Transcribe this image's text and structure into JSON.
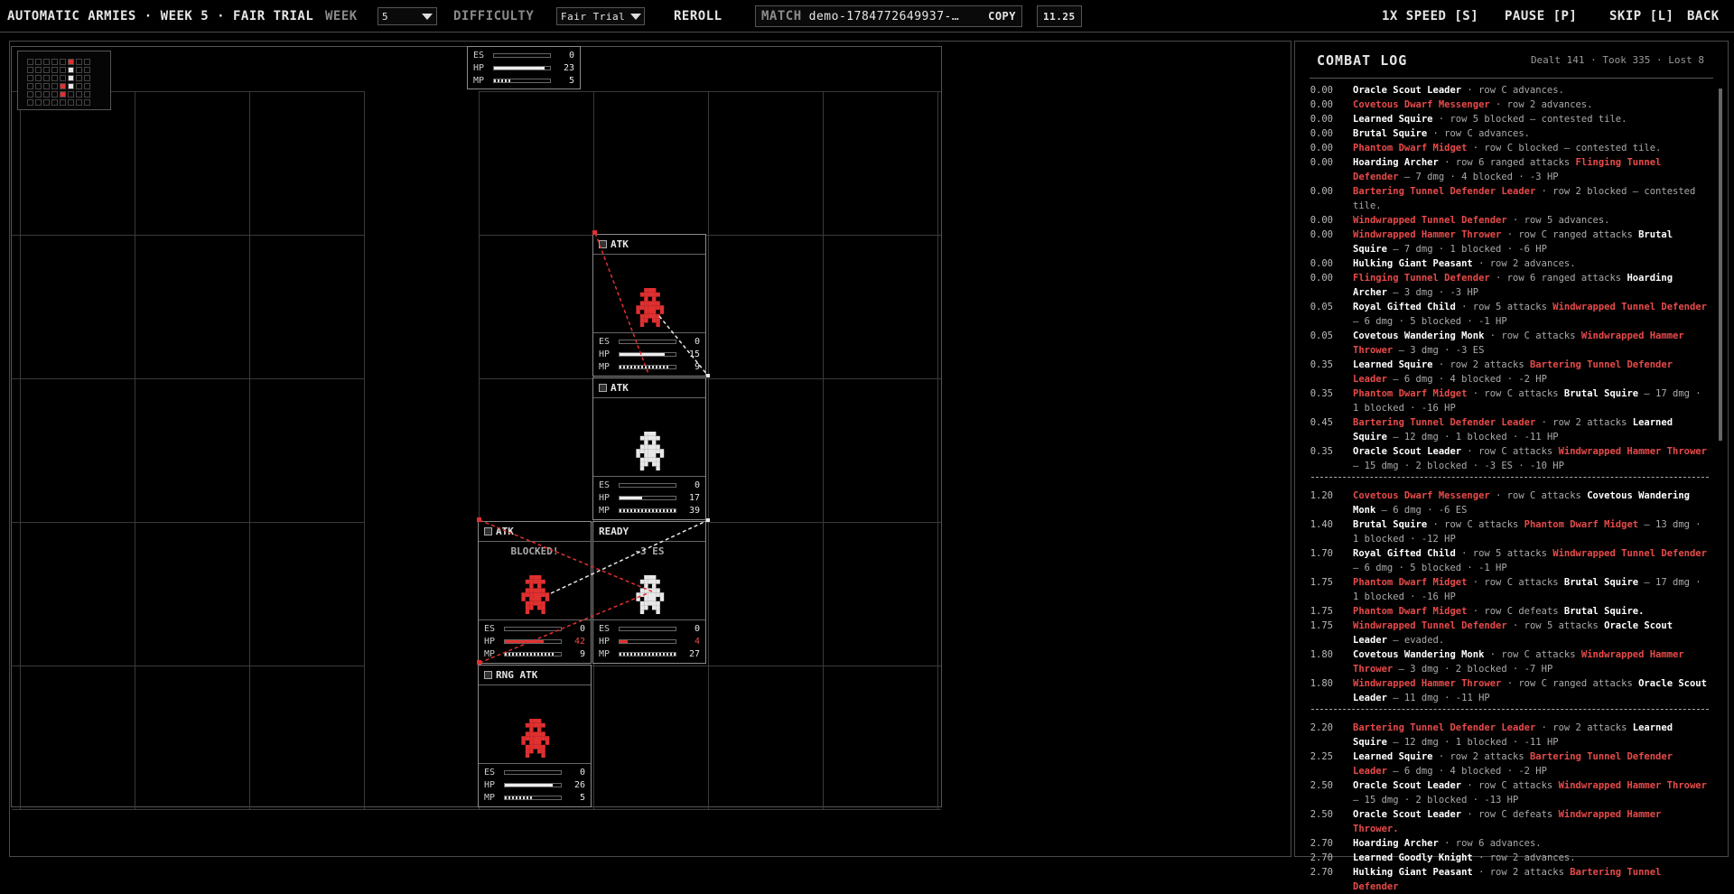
{
  "header": {
    "title": "AUTOMATIC ARMIES · WEEK 5 · FAIR TRIAL",
    "week_label": "WEEK",
    "week_value": "5",
    "difficulty_label": "DIFFICULTY",
    "difficulty_value": "Fair Trial",
    "reroll": "REROLL",
    "match_label": "MATCH",
    "match_id": "demo-1784772649937-…",
    "copy": "COPY",
    "version": "11.25",
    "speed": "1X SPEED [S]",
    "pause": "PAUSE [P]",
    "skip": "SKIP [L]",
    "back": "BACK"
  },
  "topcard": {
    "es": "0",
    "hp": "23",
    "mp": "5",
    "es_frac": 0,
    "hp_frac": 0.9,
    "mp_frac": 0.3
  },
  "units": [
    {
      "id": "u1",
      "col": 5,
      "row": 1,
      "status": "ATK",
      "overtext": "",
      "color": "#e03030",
      "es": "0",
      "hp": "15",
      "mp": "9",
      "hp_frac": 0.8,
      "mp_frac": 0.9,
      "hp_red": false
    },
    {
      "id": "u2",
      "col": 5,
      "row": 2,
      "status": "ATK",
      "overtext": "",
      "color": "#e8e8e8",
      "es": "0",
      "hp": "17",
      "mp": "39",
      "hp_frac": 0.4,
      "mp_frac": 1.0,
      "hp_red": false
    },
    {
      "id": "u3",
      "col": 4,
      "row": 3,
      "status": "ATK",
      "overtext": "BLOCKED!",
      "color": "#e03030",
      "es": "0",
      "hp": "42",
      "mp": "9",
      "hp_frac": 0.7,
      "mp_frac": 0.9,
      "hp_red": true
    },
    {
      "id": "u4",
      "col": 5,
      "row": 3,
      "status": "READY",
      "overtext": "-3 ES",
      "color": "#e8e8e8",
      "es": "0",
      "hp": "4",
      "mp": "27",
      "hp_frac": 0.15,
      "mp_frac": 1.0,
      "hp_red": true
    },
    {
      "id": "u5",
      "col": 4,
      "row": 4,
      "status": "RNG ATK",
      "overtext": "",
      "color": "#e03030",
      "es": "0",
      "hp": "26",
      "mp": "5",
      "hp_frac": 0.85,
      "mp_frac": 0.5,
      "hp_red": false
    }
  ],
  "stat_labels": {
    "es": "ES",
    "hp": "HP",
    "mp": "MP"
  },
  "log": {
    "title": "COMBAT LOG",
    "stats": "Dealt 141 · Took 335 · Lost 8",
    "entries": [
      {
        "t": "0.00",
        "parts": [
          [
            "w",
            "Oracle Scout Leader"
          ],
          [
            "n",
            " · row C advances."
          ]
        ]
      },
      {
        "t": "0.00",
        "parts": [
          [
            "r",
            "Covetous Dwarf Messenger"
          ],
          [
            "n",
            " · row 2 advances."
          ]
        ]
      },
      {
        "t": "0.00",
        "parts": [
          [
            "w",
            "Learned Squire"
          ],
          [
            "n",
            " · row 5 blocked — contested tile."
          ]
        ]
      },
      {
        "t": "0.00",
        "parts": [
          [
            "w",
            "Brutal Squire"
          ],
          [
            "n",
            " · row C advances."
          ]
        ]
      },
      {
        "t": "0.00",
        "parts": [
          [
            "r",
            "Phantom Dwarf Midget"
          ],
          [
            "n",
            " · row C blocked — contested tile."
          ]
        ]
      },
      {
        "t": "0.00",
        "parts": [
          [
            "w",
            "Hoarding Archer"
          ],
          [
            "n",
            " · row 6 ranged attacks "
          ],
          [
            "r",
            "Flinging Tunnel Defender"
          ],
          [
            "n",
            " — 7 dmg · 4 blocked · -3 HP"
          ]
        ]
      },
      {
        "t": "0.00",
        "parts": [
          [
            "r",
            "Bartering Tunnel Defender Leader"
          ],
          [
            "n",
            " · row 2 blocked — contested tile."
          ]
        ]
      },
      {
        "t": "0.00",
        "parts": [
          [
            "r",
            "Windwrapped Tunnel Defender"
          ],
          [
            "n",
            " · row 5 advances."
          ]
        ]
      },
      {
        "t": "0.00",
        "parts": [
          [
            "r",
            "Windwrapped Hammer Thrower"
          ],
          [
            "n",
            " · row C ranged attacks "
          ],
          [
            "w",
            "Brutal Squire"
          ],
          [
            "n",
            " — 7 dmg · 1 blocked · -6 HP"
          ]
        ]
      },
      {
        "t": "0.00",
        "parts": [
          [
            "w",
            "Hulking Giant Peasant"
          ],
          [
            "n",
            " · row 2 advances."
          ]
        ]
      },
      {
        "t": "0.00",
        "parts": [
          [
            "r",
            "Flinging Tunnel Defender"
          ],
          [
            "n",
            " · row 6 ranged attacks "
          ],
          [
            "w",
            "Hoarding Archer"
          ],
          [
            "n",
            " — 3 dmg · -3 HP"
          ]
        ]
      },
      {
        "t": "0.05",
        "parts": [
          [
            "w",
            "Royal Gifted Child"
          ],
          [
            "n",
            " · row 5 attacks "
          ],
          [
            "r",
            "Windwrapped Tunnel Defender"
          ],
          [
            "n",
            " — 6 dmg · 5 blocked · -1 HP"
          ]
        ]
      },
      {
        "t": "0.05",
        "parts": [
          [
            "w",
            "Covetous Wandering Monk"
          ],
          [
            "n",
            " · row C attacks "
          ],
          [
            "r",
            "Windwrapped Hammer Thrower"
          ],
          [
            "n",
            " — 3 dmg · -3 ES"
          ]
        ]
      },
      {
        "t": "0.35",
        "parts": [
          [
            "w",
            "Learned Squire"
          ],
          [
            "n",
            " · row 2 attacks "
          ],
          [
            "r",
            "Bartering Tunnel Defender Leader"
          ],
          [
            "n",
            " — 6 dmg · 4 blocked · -2 HP"
          ]
        ]
      },
      {
        "t": "0.35",
        "parts": [
          [
            "r",
            "Phantom Dwarf Midget"
          ],
          [
            "n",
            " · row C attacks "
          ],
          [
            "w",
            "Brutal Squire"
          ],
          [
            "n",
            " — 17 dmg · 1 blocked · -16 HP"
          ]
        ]
      },
      {
        "t": "0.45",
        "parts": [
          [
            "r",
            "Bartering Tunnel Defender Leader"
          ],
          [
            "n",
            " · row 2 attacks "
          ],
          [
            "w",
            "Learned Squire"
          ],
          [
            "n",
            " — 12 dmg · 1 blocked · -11 HP"
          ]
        ]
      },
      {
        "t": "0.35",
        "parts": [
          [
            "w",
            "Oracle Scout Leader"
          ],
          [
            "n",
            " · row C attacks "
          ],
          [
            "r",
            "Windwrapped Hammer Thrower"
          ],
          [
            "n",
            " — 15 dmg · 2 blocked · -3 ES · -10 HP"
          ]
        ]
      },
      {
        "divider": true
      },
      {
        "t": "1.20",
        "parts": [
          [
            "r",
            "Covetous Dwarf Messenger"
          ],
          [
            "n",
            " · row C attacks "
          ],
          [
            "w",
            "Covetous Wandering Monk"
          ],
          [
            "n",
            " — 6 dmg · -6 ES"
          ]
        ]
      },
      {
        "t": "1.40",
        "parts": [
          [
            "w",
            "Brutal Squire"
          ],
          [
            "n",
            " · row C attacks "
          ],
          [
            "r",
            "Phantom Dwarf Midget"
          ],
          [
            "n",
            " — 13 dmg · 1 blocked · -12 HP"
          ]
        ]
      },
      {
        "t": "1.70",
        "parts": [
          [
            "w",
            "Royal Gifted Child"
          ],
          [
            "n",
            " · row 5 attacks "
          ],
          [
            "r",
            "Windwrapped Tunnel Defender"
          ],
          [
            "n",
            " — 6 dmg · 5 blocked · -1 HP"
          ]
        ]
      },
      {
        "t": "1.75",
        "parts": [
          [
            "r",
            "Phantom Dwarf Midget"
          ],
          [
            "n",
            " · row C attacks "
          ],
          [
            "w",
            "Brutal Squire"
          ],
          [
            "n",
            " — 17 dmg · 1 blocked · -16 HP"
          ]
        ]
      },
      {
        "t": "1.75",
        "parts": [
          [
            "r",
            "Phantom Dwarf Midget"
          ],
          [
            "n",
            " · row C defeats "
          ],
          [
            "w",
            "Brutal Squire."
          ]
        ]
      },
      {
        "t": "1.75",
        "parts": [
          [
            "r",
            "Windwrapped Tunnel Defender"
          ],
          [
            "n",
            " · row 5 attacks "
          ],
          [
            "w",
            "Oracle Scout Leader"
          ],
          [
            "n",
            " — evaded."
          ]
        ]
      },
      {
        "t": "1.80",
        "parts": [
          [
            "w",
            "Covetous Wandering Monk"
          ],
          [
            "n",
            " · row C attacks "
          ],
          [
            "r",
            "Windwrapped Hammer Thrower"
          ],
          [
            "n",
            " — 3 dmg · 2 blocked · -7 HP"
          ]
        ]
      },
      {
        "t": "1.80",
        "parts": [
          [
            "r",
            "Windwrapped Hammer Thrower"
          ],
          [
            "n",
            " · row C ranged attacks "
          ],
          [
            "w",
            "Oracle Scout Leader"
          ],
          [
            "n",
            " — 11 dmg · -11 HP"
          ]
        ]
      },
      {
        "divider": true
      },
      {
        "t": "2.20",
        "parts": [
          [
            "r",
            "Bartering Tunnel Defender Leader"
          ],
          [
            "n",
            " · row 2 attacks "
          ],
          [
            "w",
            "Learned Squire"
          ],
          [
            "n",
            " — 12 dmg · 1 blocked · -11 HP"
          ]
        ]
      },
      {
        "t": "2.25",
        "parts": [
          [
            "w",
            "Learned Squire"
          ],
          [
            "n",
            " · row 2 attacks "
          ],
          [
            "r",
            "Bartering Tunnel Defender Leader"
          ],
          [
            "n",
            " — 6 dmg · 4 blocked · -2 HP"
          ]
        ]
      },
      {
        "t": "2.50",
        "parts": [
          [
            "w",
            "Oracle Scout Leader"
          ],
          [
            "n",
            " · row C attacks "
          ],
          [
            "r",
            "Windwrapped Hammer Thrower"
          ],
          [
            "n",
            " — 15 dmg · 2 blocked · -13 HP"
          ]
        ]
      },
      {
        "t": "2.50",
        "parts": [
          [
            "w",
            "Oracle Scout Leader"
          ],
          [
            "n",
            " · row C defeats "
          ],
          [
            "r",
            "Windwrapped Hammer Thrower."
          ]
        ]
      },
      {
        "t": "2.70",
        "parts": [
          [
            "w",
            "Hoarding Archer"
          ],
          [
            "n",
            " · row 6 advances."
          ]
        ]
      },
      {
        "t": "2.70",
        "parts": [
          [
            "w",
            "Learned Goodly Knight"
          ],
          [
            "n",
            " · row 2 advances."
          ]
        ]
      },
      {
        "t": "2.70",
        "parts": [
          [
            "w",
            "Hulking Giant Peasant"
          ],
          [
            "n",
            " · row 2 attacks "
          ],
          [
            "r",
            "Bartering Tunnel Defender"
          ]
        ]
      }
    ]
  }
}
